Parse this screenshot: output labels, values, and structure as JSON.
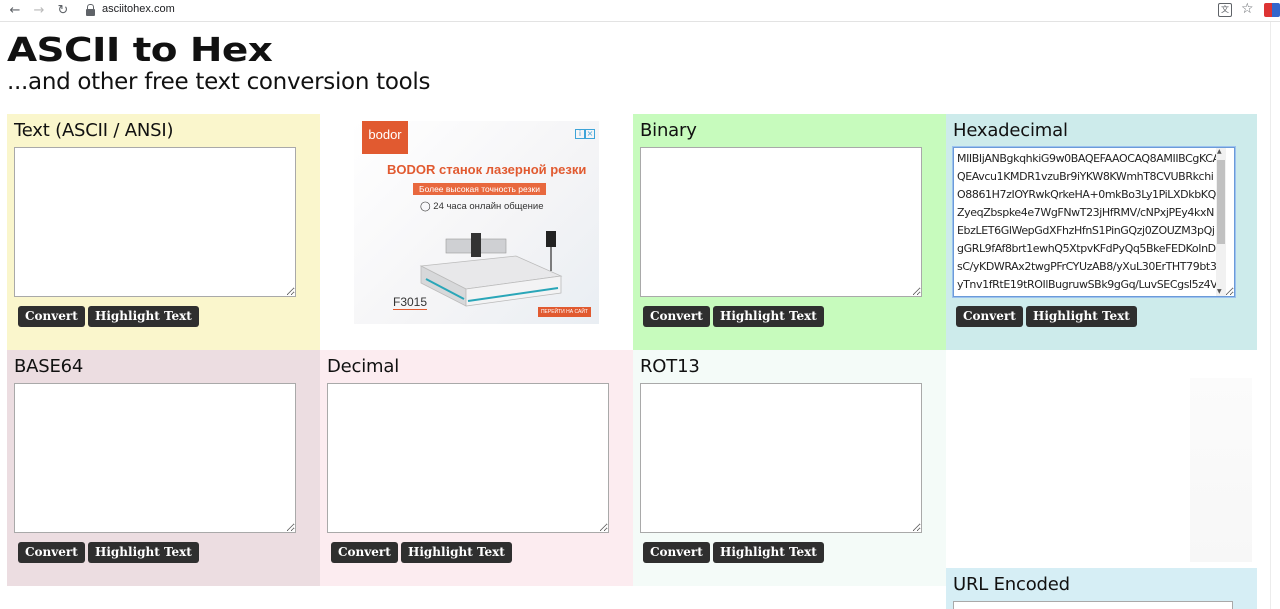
{
  "browser": {
    "url": "asciitohex.com"
  },
  "header": {
    "logo": "ASCII to Hex",
    "tagline": "...and other free text conversion tools"
  },
  "buttons": {
    "convert": "Convert",
    "highlight": "Highlight Text"
  },
  "panels": {
    "text": {
      "title": "Text (ASCII / ANSI)",
      "value": ""
    },
    "binary": {
      "title": "Binary",
      "value": ""
    },
    "hex": {
      "title": "Hexadecimal",
      "value": "MIIBIjANBgkqhkiG9w0BAQEFAAOCAQ8AMIIBCgKCAQEAvcu1KMDR1vzuBr9iYKW8KWmhT8CVUBRkchiO8861H7zIOYRwkQrkeHA+0mkBo3Ly1PiLXDkbKQZyeqZbspke4e7WgFNwT23jHfRMV/cNPxjPEy4kxNEbzLET6GlWepGdXFhzHfnS1PinGQzj0ZOUZM3pQjgGRL9fAf8brt1ewhQ5XtpvKFdPyQq5BkeFEDKoInDsC/yKDWRAx2twgPFrCYUzAB8/yXuL30ErTHT79bt3yTnv1fRtE19tROIlBugruwSBk9gGq/LuvSECgsl5z4Vc"
    },
    "base64": {
      "title": "BASE64",
      "value": ""
    },
    "decimal": {
      "title": "Decimal",
      "value": ""
    },
    "rot13": {
      "title": "ROT13",
      "value": ""
    },
    "url": {
      "title": "URL Encoded"
    }
  },
  "ad": {
    "brand": "bodor",
    "headline": "BODOR станок лазерной резки",
    "pill": "Более высокая точность резки",
    "support": "24 часа онлайн общение",
    "model": "F3015",
    "cta": "ПЕРЕЙТИ НА САЙТ"
  },
  "colors": {
    "text_panel": "#faf6cc",
    "binary_panel": "#c7fbbd",
    "hex_panel": "#cdebeb",
    "base64_panel": "#ecdde1",
    "decimal_panel": "#fcecf0",
    "rot13_panel": "#f4fbf8",
    "url_panel": "#d6eef5",
    "button": "#2f2f2f",
    "ad_accent": "#e15a30"
  },
  "icons": [
    "back-arrow-icon",
    "forward-arrow-icon",
    "reload-icon",
    "lock-icon",
    "translate-icon",
    "star-icon",
    "extension-icon",
    "adchoices-icon",
    "close-ad-icon"
  ]
}
